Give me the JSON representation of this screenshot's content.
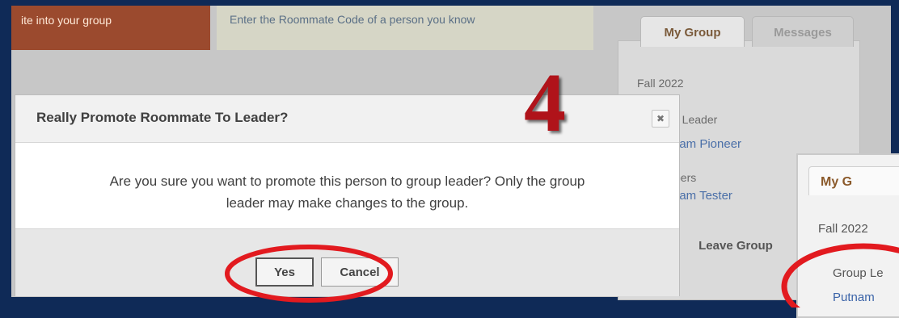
{
  "top_tabs": {
    "invite_label": "ite into your group",
    "roommate_code_label": "Enter the Roommate Code of a person you know"
  },
  "sidebar": {
    "tabs": [
      "My Group",
      "Messages"
    ],
    "term": "Fall 2022",
    "leader_label": "p Leader",
    "leader_name": "nam Pioneer",
    "members_label": "bers",
    "member_name": "nam Tester",
    "leave_button": "Leave Group"
  },
  "dialog": {
    "title": "Really Promote Roommate To Leader?",
    "close_glyph": "✖",
    "message_line1": "Are you sure you want to promote this person to group leader? Only the group",
    "message_line2": "leader may make changes to the group.",
    "yes_label": "Yes",
    "cancel_label": "Cancel"
  },
  "step_number": "4",
  "mini_panel": {
    "tab_label": "My G",
    "term": "Fall 2022",
    "leader_label": "Group Le",
    "leader_name": "Putnam"
  },
  "colors": {
    "background": "#0f2a57",
    "highlight_circle": "#e21a1f",
    "step_number": "#b0131a"
  }
}
